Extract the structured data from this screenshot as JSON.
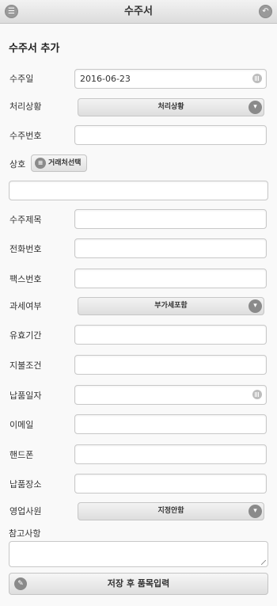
{
  "header": {
    "title": "수주서",
    "menu_icon": "menu-icon",
    "back_icon": "back-icon"
  },
  "form": {
    "title": "수주서 추가",
    "order_date": {
      "label": "수주일",
      "value": "2016-06-23"
    },
    "status": {
      "label": "처리상황",
      "selected": "처리상황"
    },
    "order_no": {
      "label": "수주번호",
      "value": ""
    },
    "company": {
      "label": "상호",
      "button": "거래처선택",
      "value": ""
    },
    "subject": {
      "label": "수주제목",
      "value": ""
    },
    "phone": {
      "label": "전화번호",
      "value": ""
    },
    "fax": {
      "label": "팩스번호",
      "value": ""
    },
    "tax": {
      "label": "과세여부",
      "selected": "부가세포함"
    },
    "validity": {
      "label": "유효기간",
      "value": ""
    },
    "payment": {
      "label": "지불조건",
      "value": ""
    },
    "delivery_date": {
      "label": "납품일자",
      "value": ""
    },
    "email": {
      "label": "이메일",
      "value": ""
    },
    "mobile": {
      "label": "핸드폰",
      "value": ""
    },
    "delivery_place": {
      "label": "납품장소",
      "value": ""
    },
    "sales_rep": {
      "label": "영업사원",
      "selected": "지정안함"
    },
    "notes": {
      "label": "참고사항",
      "value": ""
    },
    "save_button": "저장 후 품목입력"
  }
}
